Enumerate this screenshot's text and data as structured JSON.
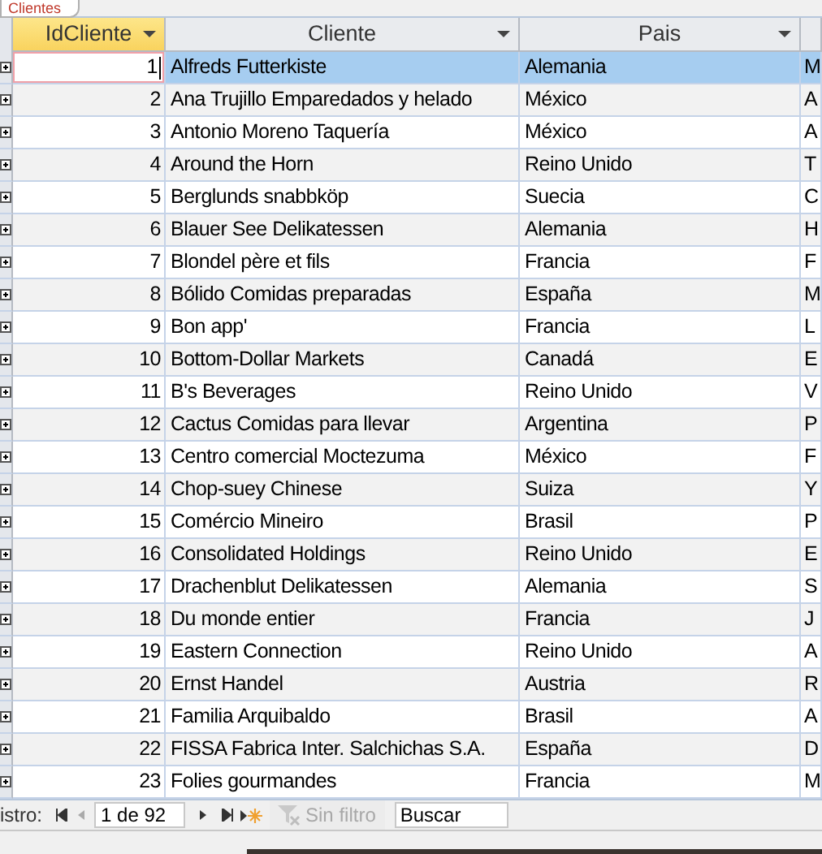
{
  "tab": {
    "label": "Clientes",
    "selected": true
  },
  "table": {
    "columns": [
      {
        "label": "IdCliente",
        "highlighted": true
      },
      {
        "label": "Cliente",
        "highlighted": false
      },
      {
        "label": "Pais",
        "highlighted": false
      }
    ],
    "rows": [
      {
        "id": "1",
        "cliente": "Alfreds Futterkiste",
        "pais": "Alemania",
        "column_4": "M",
        "selected": true
      },
      {
        "id": "2",
        "cliente": "Ana Trujillo Emparedados y helado",
        "pais": "México",
        "column_4": "A",
        "selected": false
      },
      {
        "id": "3",
        "cliente": "Antonio Moreno Taquería",
        "pais": "México",
        "column_4": "A",
        "selected": false
      },
      {
        "id": "4",
        "cliente": "Around the Horn",
        "pais": "Reino Unido",
        "column_4": "T",
        "selected": false
      },
      {
        "id": "5",
        "cliente": "Berglunds snabbköp",
        "pais": "Suecia",
        "column_4": "C",
        "selected": false
      },
      {
        "id": "6",
        "cliente": "Blauer See Delikatessen",
        "pais": "Alemania",
        "column_4": "H",
        "selected": false
      },
      {
        "id": "7",
        "cliente": "Blondel père et fils",
        "pais": "Francia",
        "column_4": "F",
        "selected": false
      },
      {
        "id": "8",
        "cliente": "Bólido Comidas preparadas",
        "pais": "España",
        "column_4": "M",
        "selected": false
      },
      {
        "id": "9",
        "cliente": "Bon app'",
        "pais": "Francia",
        "column_4": "L",
        "selected": false
      },
      {
        "id": "10",
        "cliente": "Bottom-Dollar Markets",
        "pais": "Canadá",
        "column_4": "E",
        "selected": false
      },
      {
        "id": "11",
        "cliente": "B's Beverages",
        "pais": "Reino Unido",
        "column_4": "V",
        "selected": false
      },
      {
        "id": "12",
        "cliente": "Cactus Comidas para llevar",
        "pais": "Argentina",
        "column_4": "P",
        "selected": false
      },
      {
        "id": "13",
        "cliente": "Centro comercial Moctezuma",
        "pais": "México",
        "column_4": "F",
        "selected": false
      },
      {
        "id": "14",
        "cliente": "Chop-suey Chinese",
        "pais": "Suiza",
        "column_4": "Y",
        "selected": false
      },
      {
        "id": "15",
        "cliente": "Comércio Mineiro",
        "pais": "Brasil",
        "column_4": "P",
        "selected": false
      },
      {
        "id": "16",
        "cliente": "Consolidated Holdings",
        "pais": "Reino Unido",
        "column_4": "E",
        "selected": false
      },
      {
        "id": "17",
        "cliente": "Drachenblut Delikatessen",
        "pais": "Alemania",
        "column_4": "S",
        "selected": false
      },
      {
        "id": "18",
        "cliente": "Du monde entier",
        "pais": "Francia",
        "column_4": "J",
        "selected": false
      },
      {
        "id": "19",
        "cliente": "Eastern Connection",
        "pais": "Reino Unido",
        "column_4": "A",
        "selected": false
      },
      {
        "id": "20",
        "cliente": "Ernst Handel",
        "pais": "Austria",
        "column_4": "R",
        "selected": false
      },
      {
        "id": "21",
        "cliente": "Familia Arquibaldo",
        "pais": "Brasil",
        "column_4": "A",
        "selected": false
      },
      {
        "id": "22",
        "cliente": "FISSA Fabrica Inter. Salchichas S.A.",
        "pais": "España",
        "column_4": "D",
        "selected": false
      },
      {
        "id": "23",
        "cliente": "Folies gourmandes",
        "pais": "Francia",
        "column_4": "M",
        "selected": false
      }
    ]
  },
  "nav": {
    "label": "istro:",
    "record": "1 de 92",
    "filter": {
      "label": "Sin filtro",
      "disabled": true
    },
    "search": {
      "placeholder": "Buscar"
    }
  }
}
